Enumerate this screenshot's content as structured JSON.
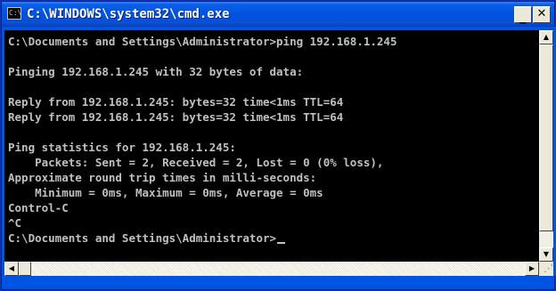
{
  "window": {
    "title": "C:\\WINDOWS\\system32\\cmd.exe",
    "icon_label": "C:\\",
    "minimize_glyph": "_",
    "close_glyph": "✕"
  },
  "console": {
    "lines": [
      "C:\\Documents and Settings\\Administrator>ping 192.168.1.245",
      "",
      "Pinging 192.168.1.245 with 32 bytes of data:",
      "",
      "Reply from 192.168.1.245: bytes=32 time<1ms TTL=64",
      "Reply from 192.168.1.245: bytes=32 time<1ms TTL=64",
      "",
      "Ping statistics for 192.168.1.245:",
      "    Packets: Sent = 2, Received = 2, Lost = 0 (0% loss),",
      "Approximate round trip times in milli-seconds:",
      "    Minimum = 0ms, Maximum = 0ms, Average = 0ms",
      "Control-C",
      "^C",
      "C:\\Documents and Settings\\Administrator>"
    ]
  },
  "scrollbars": {
    "up_arrow": "▲",
    "down_arrow": "▼",
    "left_arrow": "◀",
    "right_arrow": "▶"
  },
  "colors": {
    "titlebar": "#0054e3",
    "console_bg": "#000000",
    "console_text": "#c0c0c0"
  }
}
